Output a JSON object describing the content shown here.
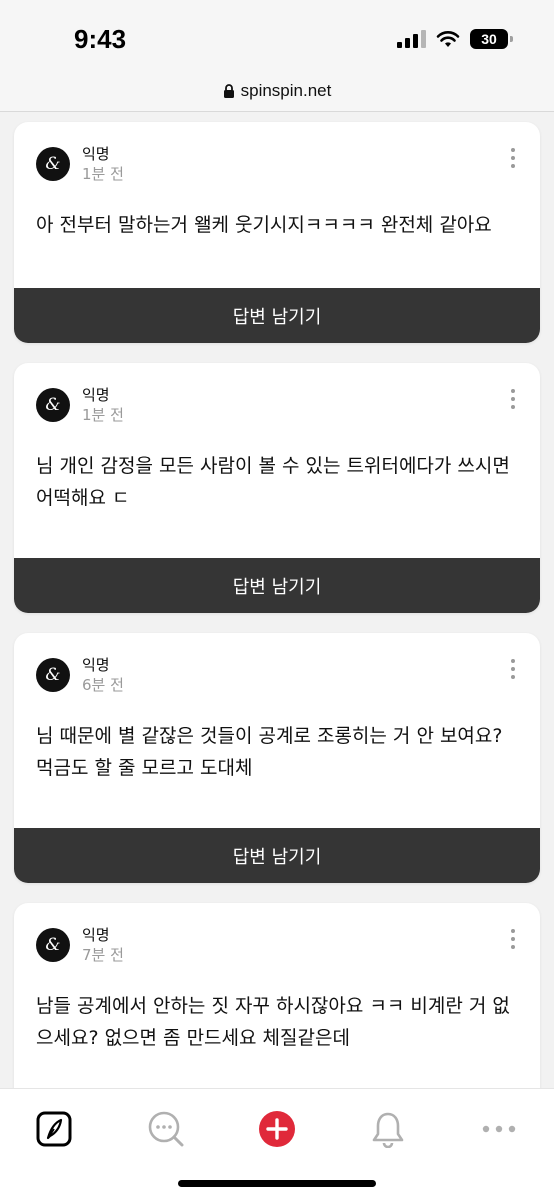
{
  "status_bar": {
    "time": "9:43",
    "battery": "30"
  },
  "browser": {
    "url": "spinspin.net"
  },
  "posts": [
    {
      "author": "익명",
      "time": "1분 전",
      "text": "아 전부터 말하는거 왤케 웃기시지ㅋㅋㅋㅋ 완전체 같아요",
      "reply_label": "답변 남기기"
    },
    {
      "author": "익명",
      "time": "1분 전",
      "text": "님 개인 감정을 모든 사람이 볼 수 있는 트위터에다가 쓰시면 어떡해요 ㄷ",
      "reply_label": "답변 남기기"
    },
    {
      "author": "익명",
      "time": "6분 전",
      "text": "님 때문에 별 같잖은 것들이 공계로 조롱히는 거 안 보여요? 먹금도 할 줄 모르고 도대체",
      "reply_label": "답변 남기기"
    },
    {
      "author": "익명",
      "time": "7분 전",
      "text": "남들 공계에서 안하는 짓 자꾸 하시잖아요 ㅋㅋ 비계란 거 없으세요? 없으면 좀 만드세요 체질같은데"
    }
  ],
  "tab_bar": {
    "icons": [
      "pen-icon",
      "chat-search-icon",
      "add-icon",
      "bell-icon",
      "more-icon"
    ],
    "accent_color": "#e0293a"
  }
}
